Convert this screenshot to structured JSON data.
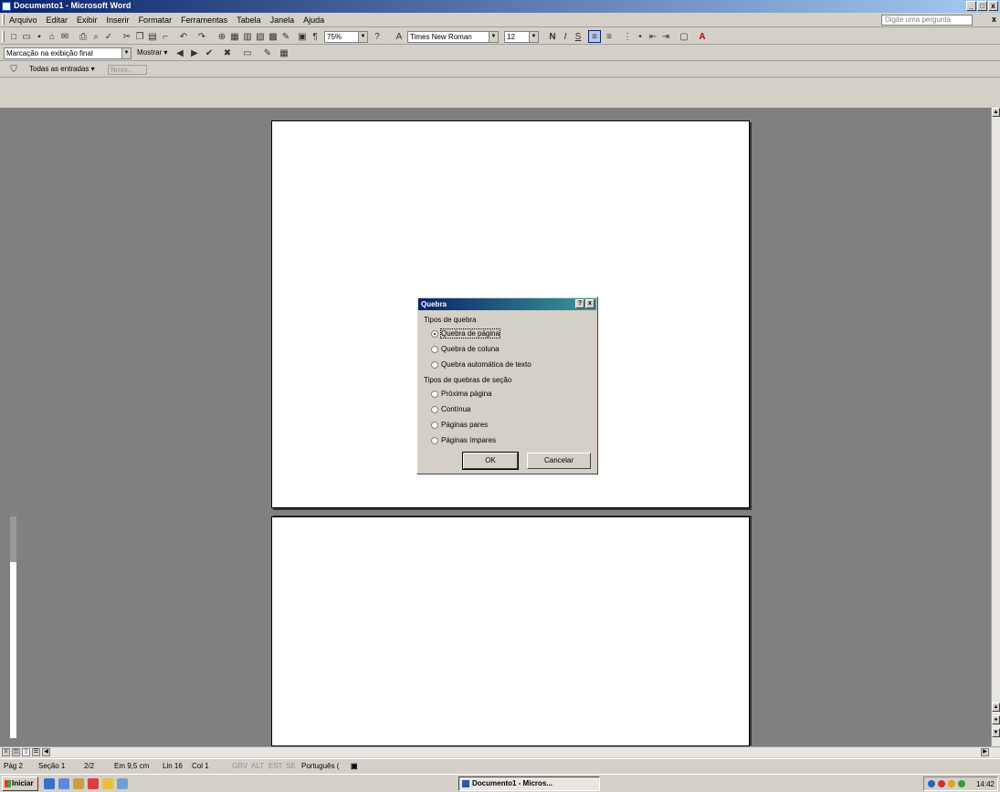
{
  "window": {
    "title": "Documento1 - Microsoft Word",
    "buttons": [
      "_",
      "□",
      "x"
    ]
  },
  "menubar": {
    "items": [
      "Arquivo",
      "Editar",
      "Exibir",
      "Inserir",
      "Formatar",
      "Ferramentas",
      "Tabela",
      "Janela",
      "Ajuda"
    ],
    "help_placeholder": "Digite uma pergunta",
    "doc_close": "x"
  },
  "toolbar_standard": {
    "zoom": "75%",
    "font": "Times New Roman",
    "size": "12"
  },
  "toolbar_review": {
    "markup_view": "Marcação na exibição final",
    "show_label": "Mostrar ▾"
  },
  "toolbar_merge": {
    "all_entries": "Todas as entradas ▾",
    "new_label": "Novo..."
  },
  "dialog": {
    "title": "Quebra",
    "help_btn": "?",
    "close_btn": "x",
    "group_break": "Tipos de quebra",
    "opt_page": "Quebra de página",
    "opt_column": "Quebra de coluna",
    "opt_text_wrap": "Quebra automática de texto",
    "group_section": "Tipos de quebras de seção",
    "opt_next_page": "Próxima página",
    "opt_continuous": "Contínua",
    "opt_even": "Páginas pares",
    "opt_odd": "Páginas ímpares",
    "ok": "OK",
    "cancel": "Cancelar",
    "selected": "opt_page"
  },
  "statusbar": {
    "page": "Pág 2",
    "section": "Seção 1",
    "pages": "2/2",
    "position": "Em 9,5 cm",
    "line": "Lin 16",
    "col": "Col 1",
    "grv": "GRV",
    "alt": "ALT",
    "est": "EST",
    "se": "SE",
    "language": "Português (",
    "status_icon": "book-icon"
  },
  "taskbar": {
    "start": "Iniciar",
    "task": "Documento1 - Micros...",
    "clock": "14:42"
  },
  "colors": {
    "title_active": "#0a246a",
    "dialog_title_end": "#3a9a9a",
    "workspace": "#808080"
  }
}
